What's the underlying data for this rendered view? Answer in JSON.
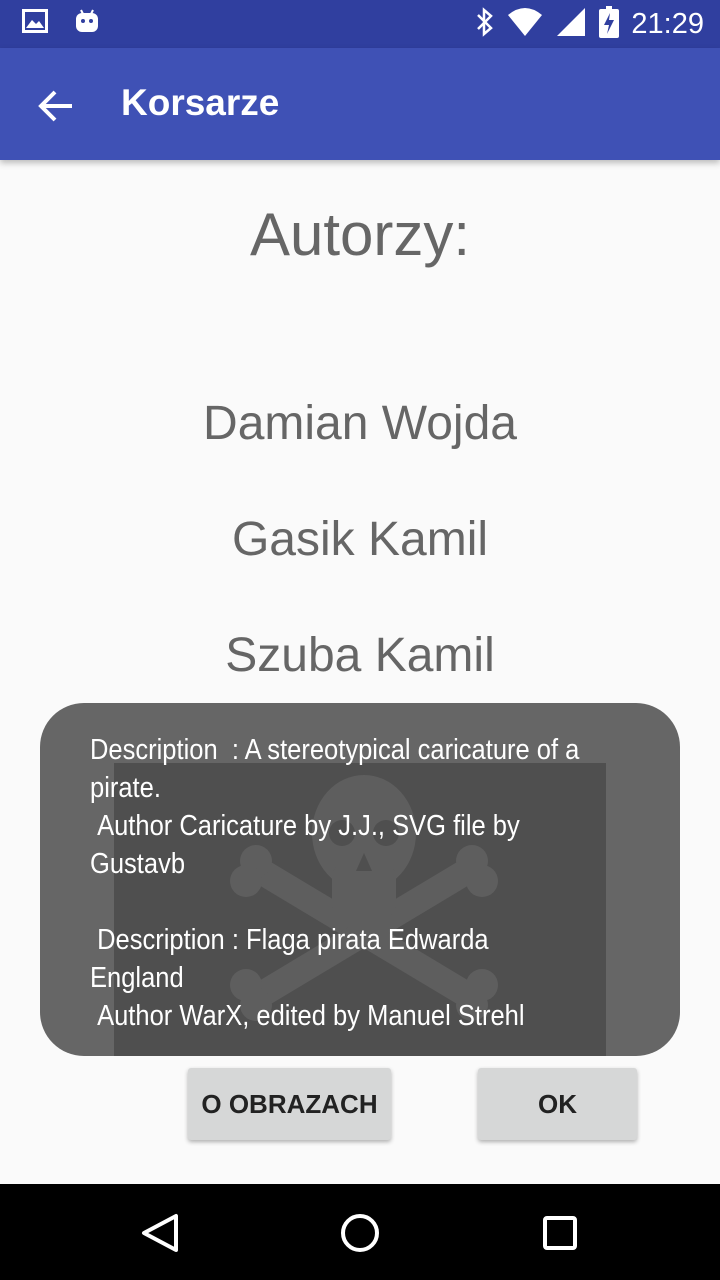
{
  "status_bar": {
    "time": "21:29",
    "icons": [
      "image-icon",
      "android-icon",
      "bluetooth-icon",
      "wifi-icon",
      "signal-icon",
      "battery-charging-icon"
    ]
  },
  "app_bar": {
    "title": "Korsarze",
    "back_icon": "arrow-back-icon"
  },
  "content": {
    "heading": "Autorzy:",
    "authors": [
      "Damian Wojda",
      "Gasik Kamil",
      "Szuba Kamil"
    ]
  },
  "buttons": {
    "about_images": "O OBRAZACH",
    "ok": "OK"
  },
  "toast": {
    "text": "Description  : A stereotypical caricature of a pirate.\n Author Caricature by J.J., SVG file by Gustavb\n\n Description : Flaga pirata Edwarda England\n Author WarX, edited by Manuel Strehl",
    "background_icon": "skull-crossbones-icon"
  },
  "nav_bar": {
    "icons": [
      "nav-back-icon",
      "nav-home-icon",
      "nav-recent-icon"
    ]
  },
  "colors": {
    "status_bar": "#303f9f",
    "app_bar": "#3f51b5",
    "background": "#fafafa",
    "toast": "#666666"
  }
}
